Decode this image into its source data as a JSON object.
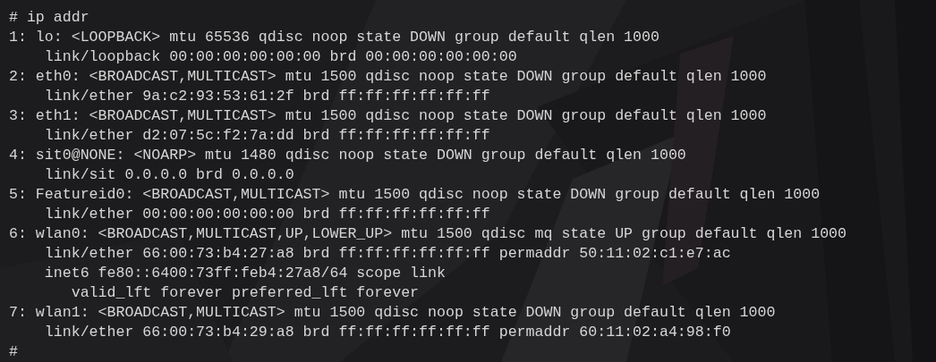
{
  "terminal": {
    "lines": [
      "# ip addr",
      "1: lo: <LOOPBACK> mtu 65536 qdisc noop state DOWN group default qlen 1000",
      "    link/loopback 00:00:00:00:00:00 brd 00:00:00:00:00:00",
      "2: eth0: <BROADCAST,MULTICAST> mtu 1500 qdisc noop state DOWN group default qlen 1000",
      "    link/ether 9a:c2:93:53:61:2f brd ff:ff:ff:ff:ff:ff",
      "3: eth1: <BROADCAST,MULTICAST> mtu 1500 qdisc noop state DOWN group default qlen 1000",
      "    link/ether d2:07:5c:f2:7a:dd brd ff:ff:ff:ff:ff:ff",
      "4: sit0@NONE: <NOARP> mtu 1480 qdisc noop state DOWN group default qlen 1000",
      "    link/sit 0.0.0.0 brd 0.0.0.0",
      "5: Featureid0: <BROADCAST,MULTICAST> mtu 1500 qdisc noop state DOWN group default qlen 1000",
      "    link/ether 00:00:00:00:00:00 brd ff:ff:ff:ff:ff:ff",
      "6: wlan0: <BROADCAST,MULTICAST,UP,LOWER_UP> mtu 1500 qdisc mq state UP group default qlen 1000",
      "    link/ether 66:00:73:b4:27:a8 brd ff:ff:ff:ff:ff:ff permaddr 50:11:02:c1:e7:ac",
      "    inet6 fe80::6400:73ff:feb4:27a8/64 scope link",
      "       valid_lft forever preferred_lft forever",
      "7: wlan1: <BROADCAST,MULTICAST> mtu 1500 qdisc noop state DOWN group default qlen 1000",
      "    link/ether 66:00:73:b4:29:a8 brd ff:ff:ff:ff:ff:ff permaddr 60:11:02:a4:98:f0",
      "#"
    ]
  }
}
